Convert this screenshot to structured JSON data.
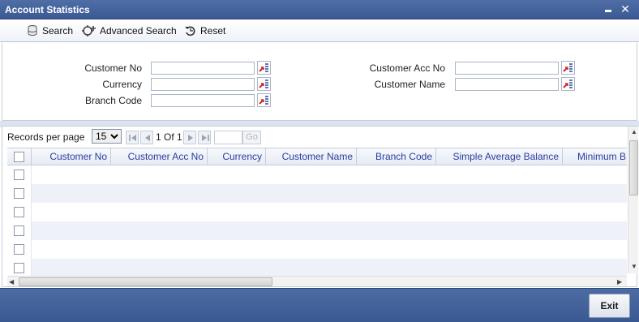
{
  "window": {
    "title": "Account Statistics"
  },
  "toolbar": {
    "search": "Search",
    "advanced_search": "Advanced Search",
    "reset": "Reset"
  },
  "form": {
    "customer_no": {
      "label": "Customer No",
      "value": ""
    },
    "currency": {
      "label": "Currency",
      "value": ""
    },
    "branch_code": {
      "label": "Branch Code",
      "value": ""
    },
    "customer_acc_no": {
      "label": "Customer Acc No",
      "value": ""
    },
    "customer_name": {
      "label": "Customer Name",
      "value": ""
    }
  },
  "pager": {
    "records_per_page_label": "Records per page",
    "records_per_page": "15",
    "page_info": "1 Of 1",
    "go_label": "Go"
  },
  "table": {
    "columns": [
      "Customer No",
      "Customer Acc No",
      "Currency",
      "Customer Name",
      "Branch Code",
      "Simple Average Balance",
      "Minimum B"
    ],
    "row_count": 6
  },
  "footer": {
    "exit_label": "Exit"
  },
  "colors": {
    "titlebar": "#3b5a94",
    "header_text": "#2a3da0",
    "alt_row": "#eef2f8"
  },
  "icons": [
    "search-icon",
    "advanced-search-icon",
    "reset-icon",
    "lov-icon",
    "first-page-icon",
    "prev-page-icon",
    "next-page-icon",
    "last-page-icon"
  ]
}
